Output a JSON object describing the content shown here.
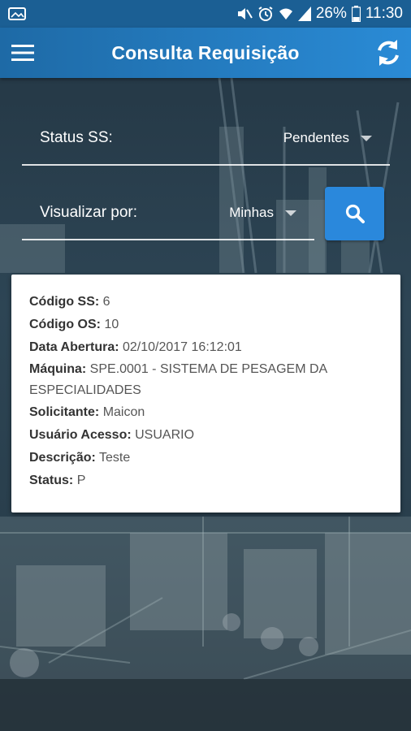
{
  "status_bar": {
    "battery_percent": "26%",
    "time": "11:30",
    "icons": [
      "gallery-notification-icon",
      "mute-icon",
      "alarm-icon",
      "wifi-icon",
      "signal-icon",
      "battery-icon"
    ]
  },
  "app_bar": {
    "title": "Consulta Requisição",
    "menu_icon": "hamburger-menu-icon",
    "refresh_icon": "refresh-icon"
  },
  "filters": {
    "status_label": "Status SS:",
    "status_value": "Pendentes",
    "view_label": "Visualizar por:",
    "view_value": "Minhas",
    "search_icon": "search-icon"
  },
  "colors": {
    "status_bar": "#1b5f94",
    "app_bar_start": "#1e6aa6",
    "app_bar_end": "#2a8bd6",
    "search_button": "#2a88dc",
    "card": "#ffffff"
  },
  "request_card": {
    "fields": [
      {
        "label": "Código SS:",
        "value": "6"
      },
      {
        "label": "Código OS:",
        "value": "10"
      },
      {
        "label": "Data Abertura:",
        "value": "02/10/2017 16:12:01"
      },
      {
        "label": "Máquina:",
        "value": "SPE.0001 - SISTEMA DE PESAGEM DA ESPECIALIDADES"
      },
      {
        "label": "Solicitante:",
        "value": "Maicon"
      },
      {
        "label": "Usuário Acesso:",
        "value": "USUARIO"
      },
      {
        "label": "Descrição:",
        "value": "Teste"
      },
      {
        "label": "Status:",
        "value": "P"
      }
    ]
  }
}
